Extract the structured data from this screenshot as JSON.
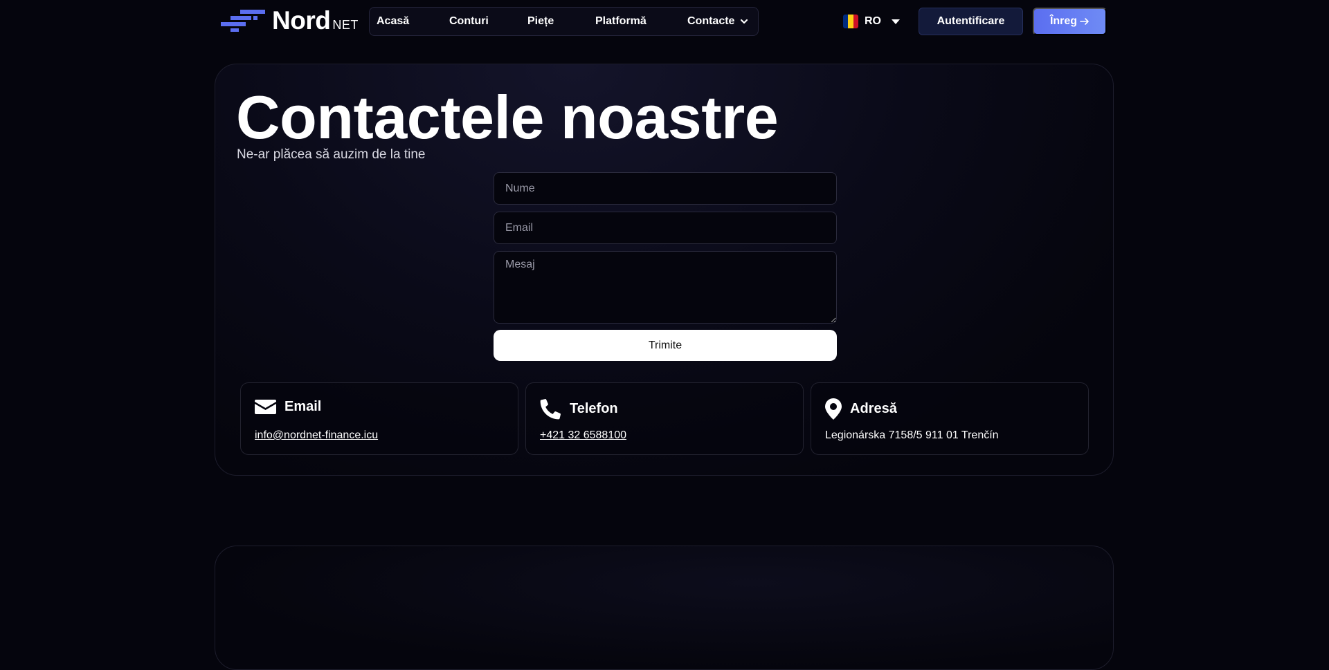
{
  "brand": {
    "name": "Nord",
    "suffix": "NET",
    "accent": "#5b6ef0"
  },
  "nav": {
    "items": [
      {
        "label": "Acasă"
      },
      {
        "label": "Conturi"
      },
      {
        "label": "Piețe"
      },
      {
        "label": "Platformă"
      },
      {
        "label": "Contacte",
        "icon": "chevron-down-icon"
      }
    ]
  },
  "language": {
    "code": "RO",
    "flag_colors": [
      "#002b7f",
      "#fcd116",
      "#ce1126"
    ]
  },
  "auth": {
    "login_label": "Autentificare",
    "register_label": "Înreg",
    "register_icon": "arrow-right-icon"
  },
  "contact": {
    "title": "Contactele noastre",
    "subtitle": "Ne-ar plăcea să auzim de la tine",
    "form": {
      "name_placeholder": "Nume",
      "email_placeholder": "Email",
      "message_placeholder": "Mesaj",
      "submit_label": "Trimite"
    },
    "cards": [
      {
        "icon": "envelope-icon",
        "label": "Email",
        "value": "info@nordnet-finance.icu"
      },
      {
        "icon": "phone-icon",
        "label": "Telefon",
        "value": "+421 32 6588100"
      },
      {
        "icon": "map-pin-icon",
        "label": "Adresă",
        "value": "Legionárska 7158/5 911 01 Trenčín"
      }
    ]
  }
}
